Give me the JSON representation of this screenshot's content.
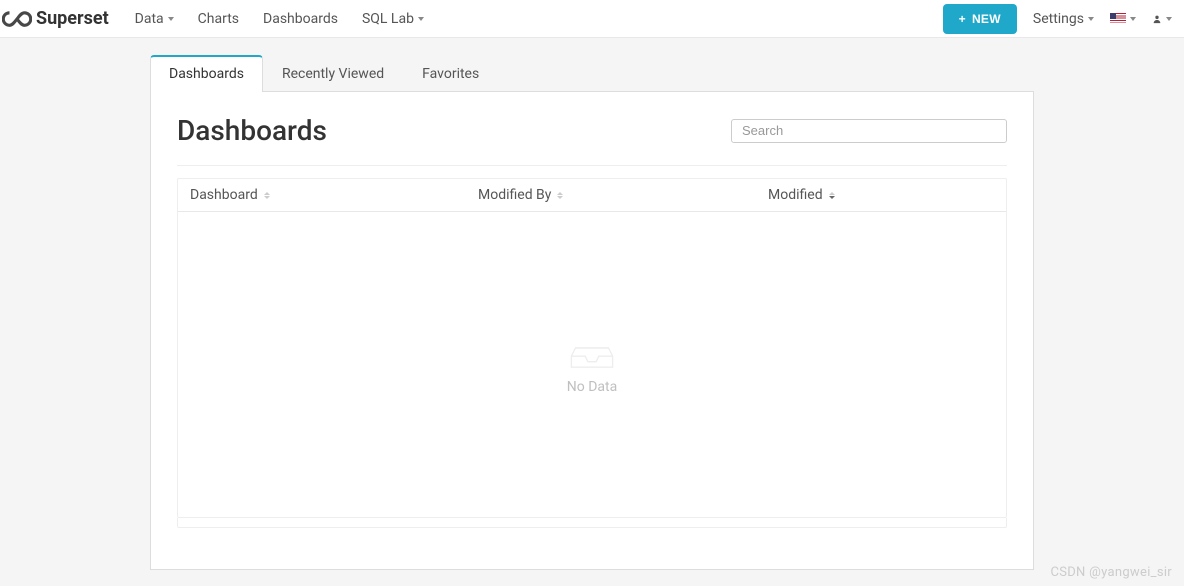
{
  "brand": {
    "name": "Superset"
  },
  "nav": {
    "data": "Data",
    "charts": "Charts",
    "dashboards": "Dashboards",
    "sqllab": "SQL Lab"
  },
  "navRight": {
    "new_label": "NEW",
    "settings_label": "Settings"
  },
  "tabs": {
    "dashboards": "Dashboards",
    "recently_viewed": "Recently Viewed",
    "favorites": "Favorites"
  },
  "page": {
    "title": "Dashboards",
    "search_placeholder": "Search"
  },
  "table": {
    "columns": {
      "dashboard": "Dashboard",
      "modified_by": "Modified By",
      "modified": "Modified"
    },
    "empty_text": "No Data"
  },
  "watermark": "CSDN @yangwei_sir"
}
